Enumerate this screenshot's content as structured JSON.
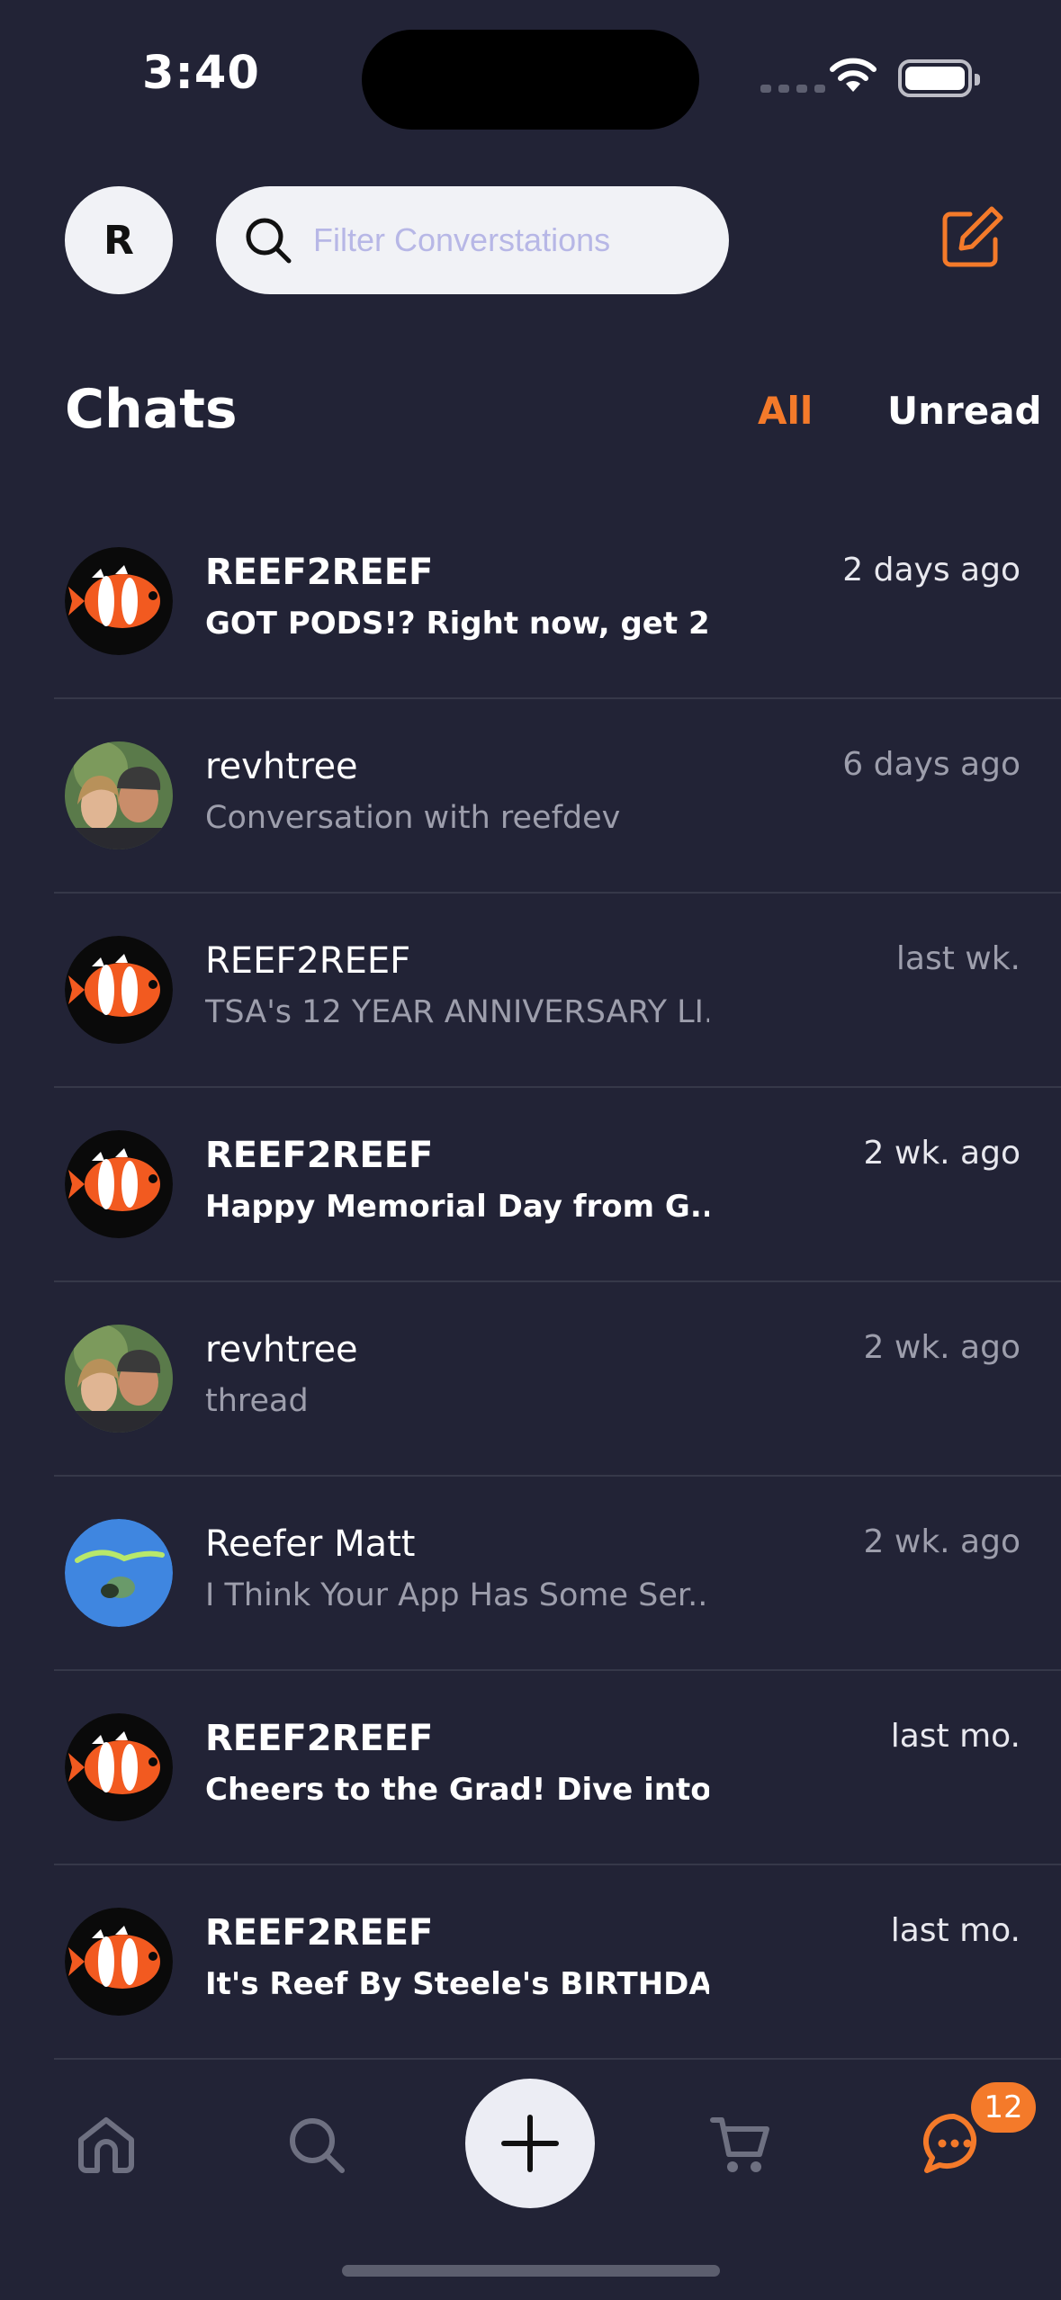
{
  "status_bar": {
    "time": "3:40"
  },
  "header": {
    "profile_initial": "R",
    "search_placeholder": "Filter Converstations"
  },
  "chats_title": "Chats",
  "filters": {
    "all": "All",
    "unread": "Unread",
    "active": "all"
  },
  "chats": [
    {
      "name": "REEF2REEF",
      "preview": "GOT PODS!? Right now, get 2...",
      "time": "2 days ago",
      "unread": true,
      "avatar": "clownfish-icon"
    },
    {
      "name": "revhtree",
      "preview": "Conversation with reefdev",
      "time": "6 days ago",
      "unread": false,
      "avatar": "couple-photo"
    },
    {
      "name": "REEF2REEF",
      "preview": "TSA's 12 YEAR ANNIVERSARY LI...",
      "time": "last wk.",
      "unread": false,
      "avatar": "clownfish-icon"
    },
    {
      "name": "REEF2REEF",
      "preview": "Happy Memorial Day from G...",
      "time": "2 wk. ago",
      "unread": true,
      "avatar": "clownfish-icon"
    },
    {
      "name": "revhtree",
      "preview": "thread",
      "time": "2 wk. ago",
      "unread": false,
      "avatar": "couple-photo"
    },
    {
      "name": "Reefer Matt",
      "preview": "I Think Your App Has Some Ser...",
      "time": "2 wk. ago",
      "unread": false,
      "avatar": "reefer-matt-logo"
    },
    {
      "name": "REEF2REEF",
      "preview": "Cheers to the Grad! Dive into...",
      "time": "last mo.",
      "unread": true,
      "avatar": "clownfish-icon"
    },
    {
      "name": "REEF2REEF",
      "preview": "It's Reef By Steele's BIRTHDA...",
      "time": "last mo.",
      "unread": true,
      "avatar": "clownfish-icon"
    }
  ],
  "bottom_nav": {
    "items": [
      "home-icon",
      "search-icon",
      "plus-icon",
      "cart-icon",
      "chat-icon"
    ],
    "chat_badge": "12"
  },
  "colors": {
    "background": "#222336",
    "accent": "#f47a2a",
    "muted_text": "#9d9eac"
  }
}
